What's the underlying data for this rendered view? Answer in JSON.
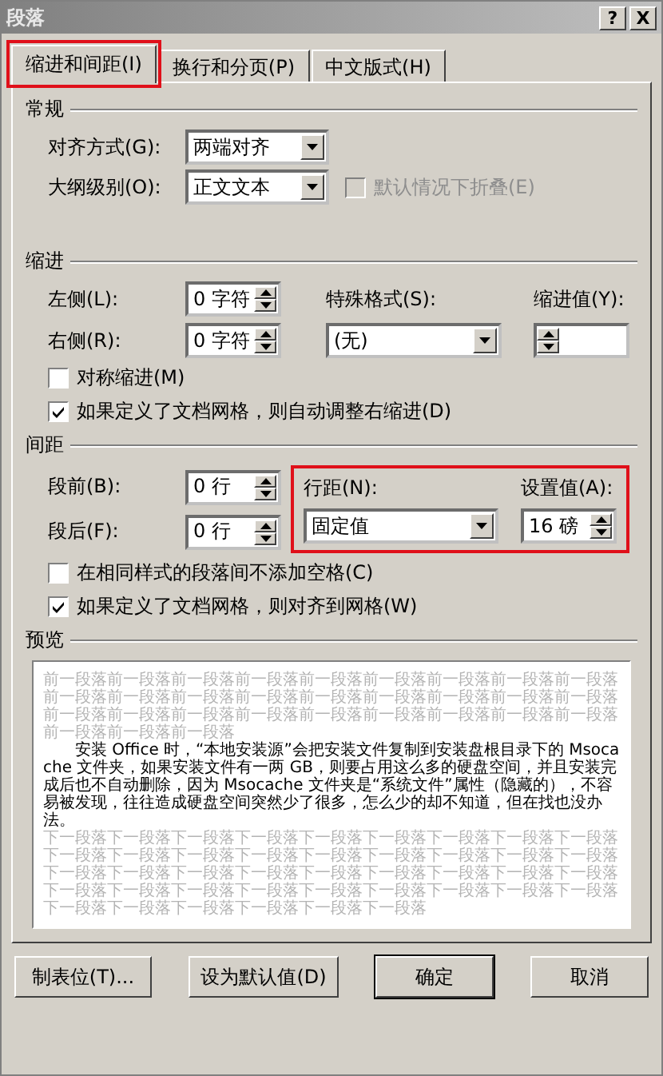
{
  "window": {
    "title": "段落",
    "help_button": "?",
    "close_button": "X"
  },
  "tabs": [
    {
      "label": "缩进和间距(I)",
      "selected": true,
      "highlighted": true
    },
    {
      "label": "换行和分页(P)",
      "selected": false,
      "highlighted": false
    },
    {
      "label": "中文版式(H)",
      "selected": false,
      "highlighted": false
    }
  ],
  "general": {
    "heading": "常规",
    "alignment": {
      "label": "对齐方式(G):",
      "value": "两端对齐"
    },
    "outline_level": {
      "label": "大纲级别(O):",
      "value": "正文文本"
    },
    "collapse_checkbox": {
      "label": "默认情况下折叠(E)",
      "checked": false,
      "disabled": true
    }
  },
  "indentation": {
    "heading": "缩进",
    "left": {
      "label": "左侧(L):",
      "value": "0 字符"
    },
    "right": {
      "label": "右侧(R):",
      "value": "0 字符"
    },
    "special": {
      "label": "特殊格式(S):",
      "value": "(无)"
    },
    "by": {
      "label": "缩进值(Y):"
    },
    "checkboxes": [
      {
        "label": "对称缩进(M)",
        "checked": false,
        "disabled": false
      },
      {
        "label": "如果定义了文档网格，则自动调整右缩进(D)",
        "checked": true,
        "disabled": false
      }
    ]
  },
  "spacing": {
    "heading": "间距",
    "before": {
      "label": "段前(B):",
      "value": "0 行"
    },
    "after": {
      "label": "段后(F):",
      "value": "0 行"
    },
    "line_spacing": {
      "label": "行距(N):",
      "value": "固定值"
    },
    "at": {
      "label": "设置值(A):",
      "value": "16 磅"
    },
    "highlighted": true,
    "checkboxes": [
      {
        "label": "在相同样式的段落间不添加空格(C)",
        "checked": false,
        "disabled": false
      },
      {
        "label": "如果定义了文档网格，则对齐到网格(W)",
        "checked": true,
        "disabled": false
      }
    ]
  },
  "preview": {
    "heading": "预览",
    "previous_text": "前一段落前一段落前一段落前一段落前一段落前一段落前一段落前一段落前一段落前一段落前一段落前一段落前一段落前一段落前一段落前一段落前一段落前一段落前一段落前一段落前一段落前一段落前一段落前一段落前一段落前一段落前一段落前一段落前一段落前一段落",
    "sample_text": "安装 Office 时，“本地安装源”会把安装文件复制到安装盘根目录下的 Msocache 文件夹，如果安装文件有一两 GB，则要占用这么多的硬盘空间，并且安装完成后也不自动删除，因为 Msocache 文件夹是“系统文件”属性（隐藏的），不容易被发现，往往造成硬盘空间突然少了很多，怎么少的却不知道，但在找也没办法。",
    "next_text": "下一段落下一段落下一段落下一段落下一段落下一段落下一段落下一段落下一段落下一段落下一段落下一段落下一段落下一段落下一段落下一段落下一段落下一段落下一段落下一段落下一段落下一段落下一段落下一段落下一段落下一段落下一段落下一段落下一段落下一段落下一段落下一段落下一段落下一段落下一段落下一段落下一段落下一段落下一段落下一段落下一段落下一段落"
  },
  "buttons": [
    {
      "label": "制表位(T)...",
      "default": false
    },
    {
      "label": "设为默认值(D)",
      "default": false
    },
    {
      "label": "确定",
      "default": true
    },
    {
      "label": "取消",
      "default": false
    }
  ]
}
